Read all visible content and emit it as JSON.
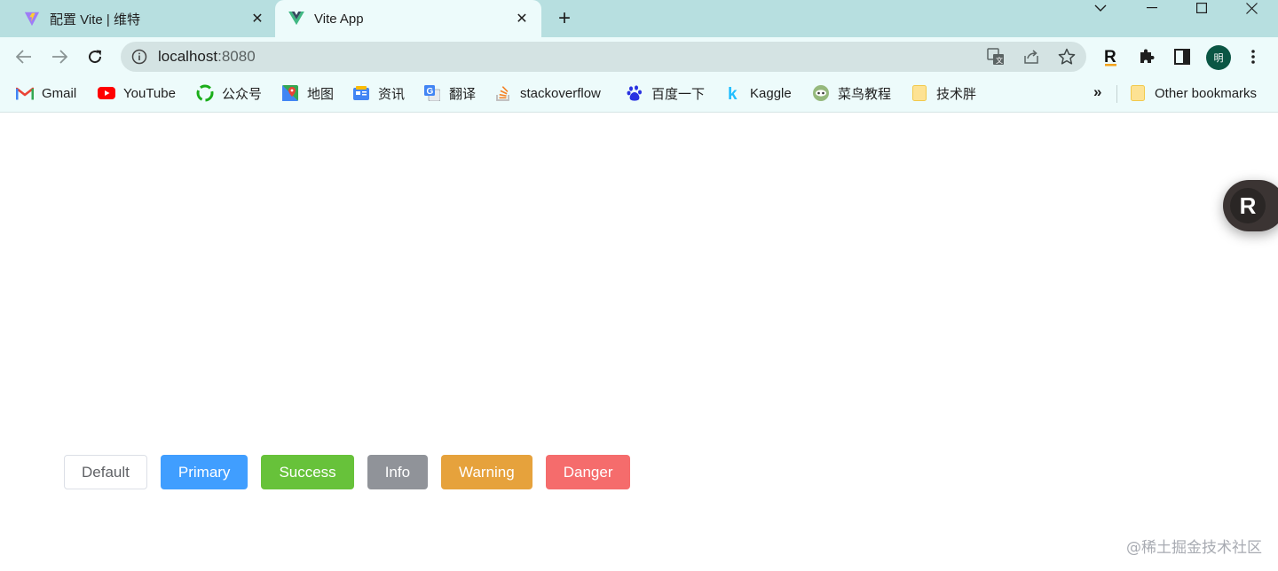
{
  "tabs": [
    {
      "title": "配置 Vite | 维特",
      "favicon": "vite-icon",
      "active": false
    },
    {
      "title": "Vite App",
      "favicon": "vue-icon",
      "active": true
    }
  ],
  "toolbar": {
    "url_host": "localhost",
    "url_port": ":8080",
    "avatar_text": "明"
  },
  "bookmarks": [
    {
      "label": "Gmail",
      "icon": "gmail-icon"
    },
    {
      "label": "YouTube",
      "icon": "youtube-icon"
    },
    {
      "label": "公众号",
      "icon": "wechat-icon"
    },
    {
      "label": "地图",
      "icon": "maps-icon"
    },
    {
      "label": "资讯",
      "icon": "news-icon"
    },
    {
      "label": "翻译",
      "icon": "translate-icon"
    },
    {
      "label": "stackoverflow",
      "icon": "stackoverflow-icon"
    },
    {
      "label": "百度一下",
      "icon": "baidu-icon"
    },
    {
      "label": "Kaggle",
      "icon": "kaggle-icon"
    },
    {
      "label": "菜鸟教程",
      "icon": "runoob-icon"
    },
    {
      "label": "技术胖",
      "icon": "folder-icon"
    }
  ],
  "bookmarks_more": "»",
  "other_bookmarks": "Other bookmarks",
  "buttons": [
    {
      "label": "Default",
      "type": "default"
    },
    {
      "label": "Primary",
      "type": "primary"
    },
    {
      "label": "Success",
      "type": "success"
    },
    {
      "label": "Info",
      "type": "info"
    },
    {
      "label": "Warning",
      "type": "warning"
    },
    {
      "label": "Danger",
      "type": "danger"
    }
  ],
  "floating_badge": "R",
  "watermark": "@稀土掘金技术社区",
  "colors": {
    "tabstrip": "#b7dfe0",
    "toolbar": "#edfbfb",
    "primary": "#409eff",
    "success": "#67c23a",
    "info": "#909399",
    "warning": "#e6a23c",
    "danger": "#f56c6c"
  }
}
